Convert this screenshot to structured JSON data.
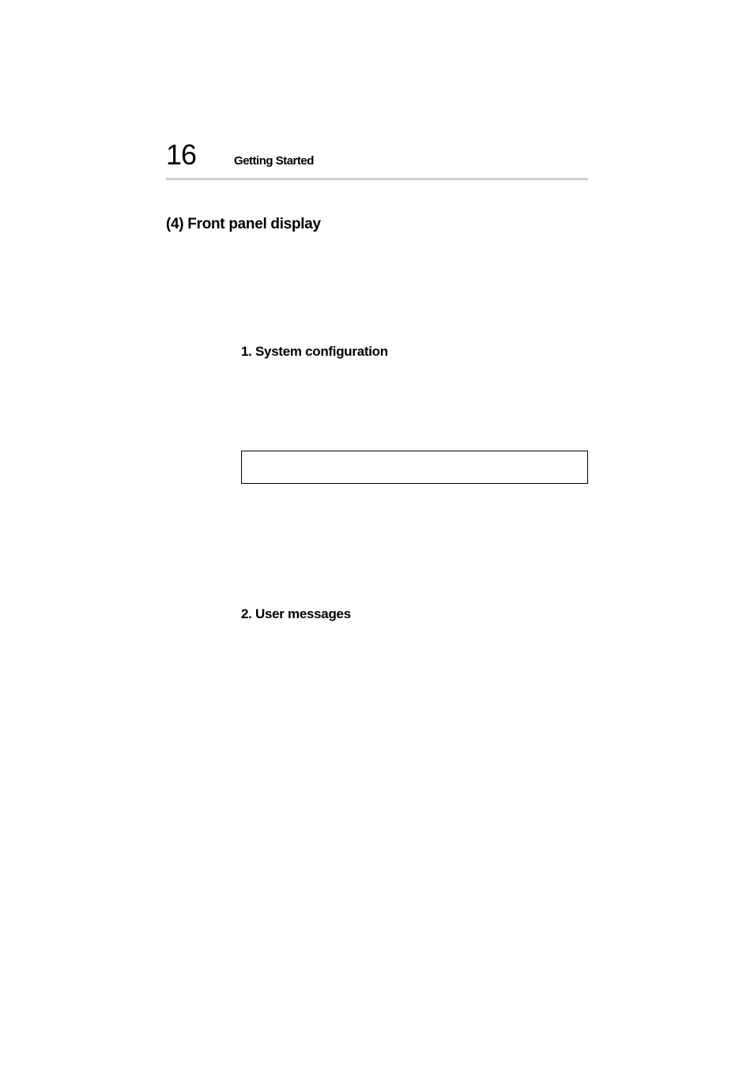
{
  "header": {
    "page_number": "16",
    "chapter_title": "Getting Started"
  },
  "section": {
    "heading": "(4) Front panel display"
  },
  "subsections": {
    "first": {
      "heading": "1. System configuration"
    },
    "second": {
      "heading": "2. User messages"
    }
  }
}
